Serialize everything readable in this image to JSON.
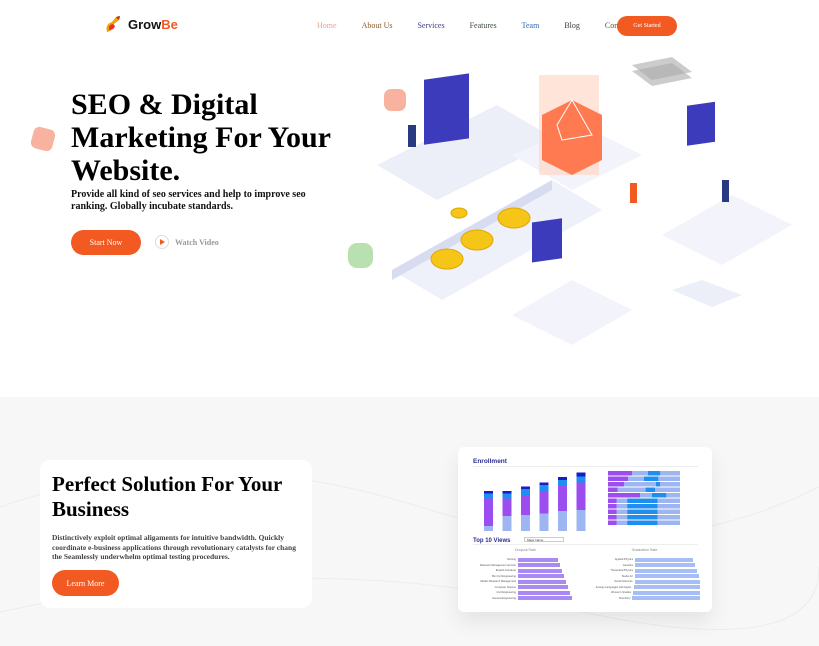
{
  "brand": {
    "name_a": "Grow",
    "name_b": "Be"
  },
  "nav": [
    {
      "label": "Home",
      "color": "#f0a090"
    },
    {
      "label": "About Us",
      "color": "#8b5a2b"
    },
    {
      "label": "Services",
      "color": "#3b3b8f"
    },
    {
      "label": "Features",
      "color": "#3a4a3a"
    },
    {
      "label": "Team",
      "color": "#2a6ab0"
    },
    {
      "label": "Blog",
      "color": "#3a3a3a"
    },
    {
      "label": "Contact",
      "color": "#6a4a2a"
    }
  ],
  "header": {
    "cta": "Get Started"
  },
  "hero": {
    "title": "SEO & Digital Marketing For Your Website.",
    "subtitle": "Provide all kind of seo services and help to improve seo ranking. Globally incubate standards.",
    "start": "Start Now",
    "watch": "Watch Video"
  },
  "solution": {
    "title": "Perfect Solution For Your Business",
    "text": "Distinctively exploit optimal aligaments for intuitive bandwidth. Quickly coordinate e-business applications through revolutionary catalysts for chang the Seamlessly underwhelm optimal testing procedures.",
    "button": "Learn More"
  },
  "dashboard": {
    "title": "Enrollment",
    "views": "Top 10 Views",
    "dropdown": "Major Name",
    "dropout": "Dropout Rate",
    "graduation": "Graduation Rate",
    "dropout_labels": [
      "Nursing",
      "Business Management and Ad.",
      "English Literature",
      "Bio Civil Engineering",
      "Market Research Management",
      "Computer Science",
      "Civil Engineering",
      "General Engineering"
    ],
    "graduation_labels": [
      "Applied Physics",
      "Genetics",
      "Theoretical Physics",
      "Studio Art",
      "Social Sciences",
      "Foreign Languages with Applic.",
      "Women's Studies",
      "Chemistry"
    ],
    "enroll_stacks": [
      [
        10,
        55,
        10,
        5
      ],
      [
        30,
        35,
        10,
        5
      ],
      [
        32,
        40,
        12,
        5
      ],
      [
        35,
        45,
        12,
        5
      ],
      [
        40,
        50,
        12,
        6
      ],
      [
        42,
        55,
        12,
        8
      ]
    ],
    "colors": [
      "#9db5f0",
      "#9b4df0",
      "#1e8ef0",
      "#1a1ac8"
    ]
  }
}
